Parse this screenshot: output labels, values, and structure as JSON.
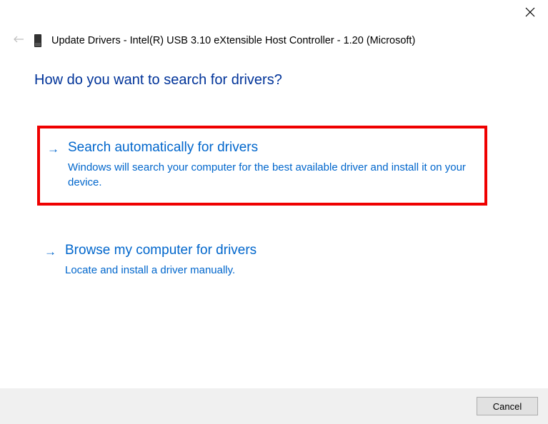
{
  "header": {
    "title": "Update Drivers - Intel(R) USB 3.10 eXtensible Host Controller - 1.20 (Microsoft)"
  },
  "main": {
    "heading": "How do you want to search for drivers?"
  },
  "options": [
    {
      "title": "Search automatically for drivers",
      "description": "Windows will search your computer for the best available driver and install it on your device."
    },
    {
      "title": "Browse my computer for drivers",
      "description": "Locate and install a driver manually."
    }
  ],
  "footer": {
    "cancel_label": "Cancel"
  }
}
